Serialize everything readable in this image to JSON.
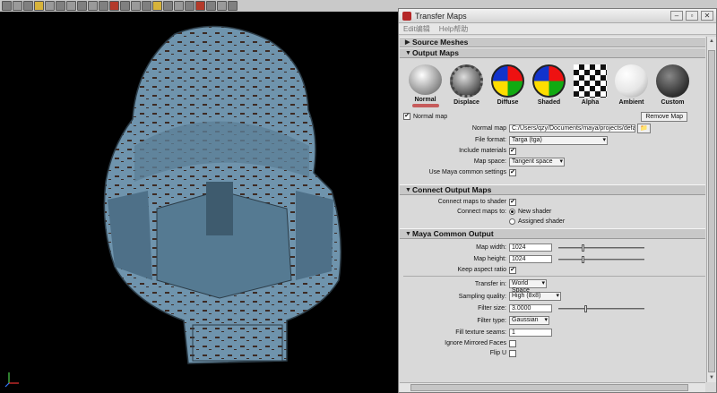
{
  "window": {
    "title": "Transfer Maps",
    "menus": [
      "Edit编辑",
      "Help帮助"
    ]
  },
  "sections": {
    "source_meshes": "Source Meshes",
    "output_maps": "Output Maps",
    "connect_output_maps": "Connect Output Maps",
    "maya_common_output": "Maya Common Output"
  },
  "map_types": [
    {
      "label": "Normal",
      "icon": "normal-map-icon"
    },
    {
      "label": "Displace",
      "icon": "displace-map-icon"
    },
    {
      "label": "Diffuse",
      "icon": "diffuse-map-icon"
    },
    {
      "label": "Shaded",
      "icon": "shaded-map-icon"
    },
    {
      "label": "Alpha",
      "icon": "alpha-map-icon"
    },
    {
      "label": "Ambient",
      "icon": "ambient-map-icon"
    },
    {
      "label": "Custom",
      "icon": "custom-map-icon"
    }
  ],
  "normal_map": {
    "checkbox_label": "Normal map",
    "checked": true,
    "remove_button": "Remove Map",
    "path_label": "Normal map",
    "path_value": "C:/Users/qzy/Documents/maya/projects/default/b",
    "file_format_label": "File format:",
    "file_format_value": "Targa (tga)",
    "include_materials_label": "Include materials",
    "map_space_label": "Map space:",
    "map_space_value": "Tangent space",
    "use_common_label": "Use Maya common settings"
  },
  "connect": {
    "connect_label": "Connect maps to shader",
    "connect_to_label": "Connect maps to:",
    "options": [
      "New shader",
      "Assigned shader"
    ]
  },
  "common": {
    "map_width_label": "Map width:",
    "map_width_value": "1024",
    "map_height_label": "Map height:",
    "map_height_value": "1024",
    "keep_aspect_label": "Keep aspect ratio",
    "transfer_in_label": "Transfer in:",
    "transfer_in_value": "World Space",
    "sampling_label": "Sampling quality:",
    "sampling_value": "High (8x8)",
    "filter_size_label": "Filter size:",
    "filter_size_value": "3.0000",
    "filter_type_label": "Filter type:",
    "filter_type_value": "Gaussian",
    "fill_seams_label": "Fill texture seams:",
    "fill_seams_value": "1",
    "ignore_mirrored_label": "Ignore Mirrored Faces",
    "flip_u_label": "Flip U"
  },
  "sliders": {
    "map_width": 0.27,
    "map_height": 0.27,
    "filter_size": 0.3
  },
  "colors": {
    "selection_bar": "#c65b5b",
    "model_tint": "#6f94ad"
  }
}
